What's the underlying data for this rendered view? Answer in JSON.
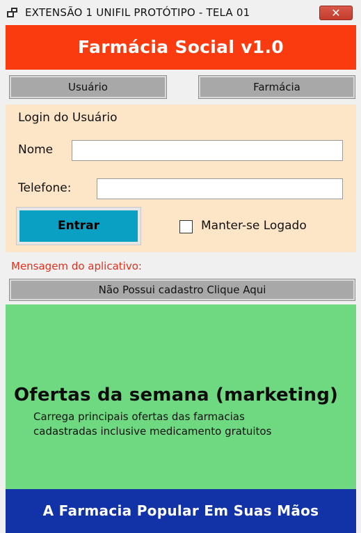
{
  "window": {
    "title": "EXTENSÃO 1   UNIFIL  PROTÓTIPO - TELA 01",
    "close_glyph": "✕",
    "icon": "app-window-icon"
  },
  "header": {
    "title": "Farmácia Social  v1.0",
    "color": "#fa3b10"
  },
  "tabs": [
    {
      "label": "Usuário"
    },
    {
      "label": "Farmácia"
    }
  ],
  "login": {
    "title": "Login do Usuário",
    "name_label": "Nome",
    "name_value": "",
    "phone_label": "Telefone:",
    "phone_value": "",
    "enter_label": "Entrar",
    "enter_color": "#0aa0c4",
    "keep_logged_label": "Manter-se Logado",
    "keep_logged_checked": false,
    "panel_color": "#fde5c8"
  },
  "message": {
    "label": "Mensagem do aplicativo:",
    "register_button": "Não Possui cadastro Clique Aqui"
  },
  "marketing": {
    "title": "Ofertas da semana (marketing)",
    "line1": "Carrega principais ofertas das farmacias",
    "line2": "cadastradas inclusive medicamento gratuitos",
    "color": "#6ed980"
  },
  "footer": {
    "text": "A Farmacia Popular Em Suas Mãos",
    "color": "#1233a8"
  }
}
